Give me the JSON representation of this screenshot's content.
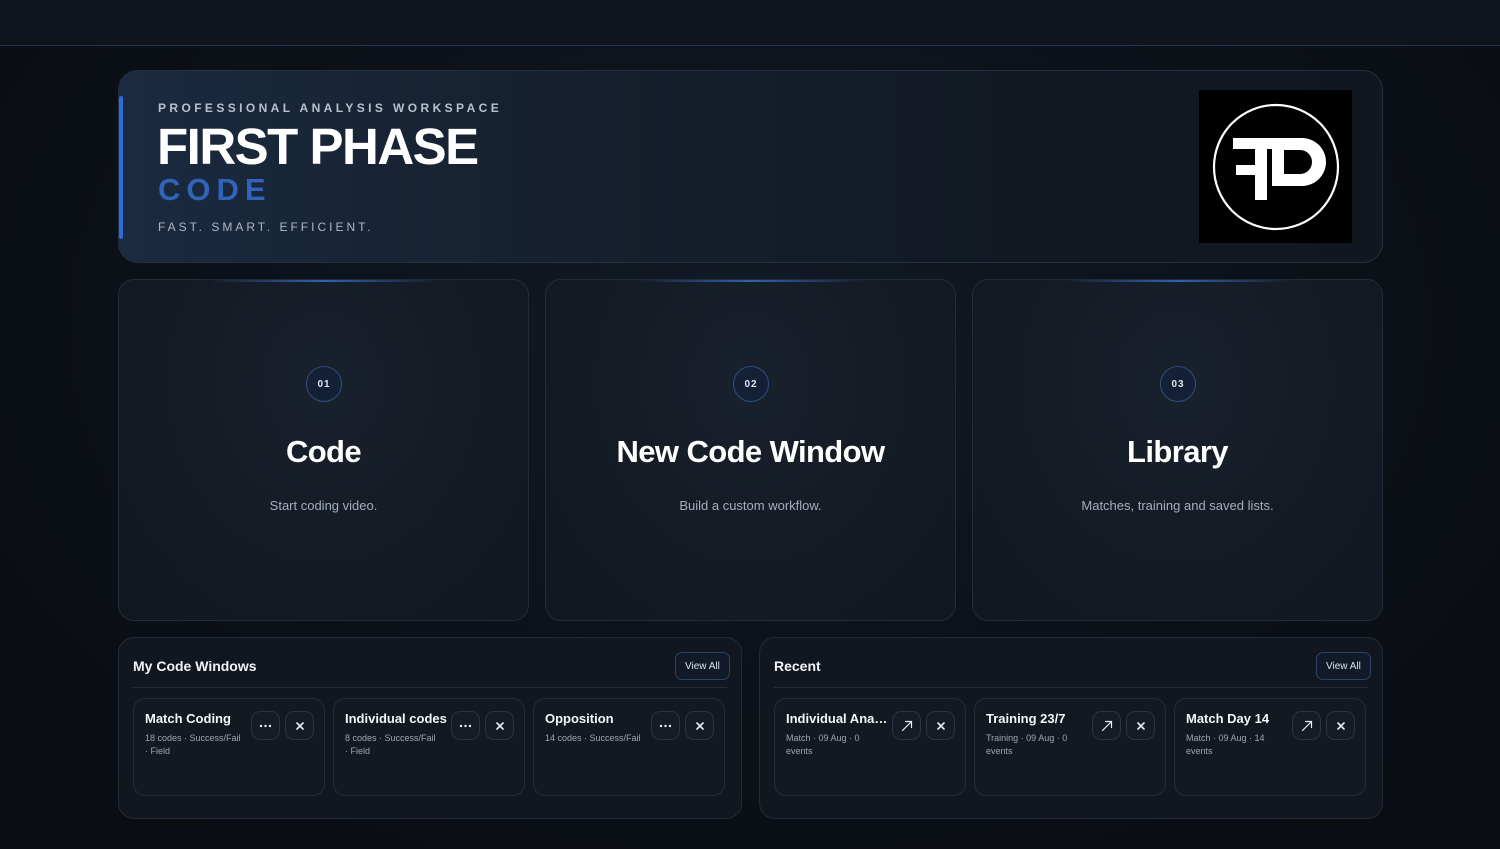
{
  "hero": {
    "eyebrow": "PROFESSIONAL ANALYSIS WORKSPACE",
    "title": "FIRST PHASE",
    "subtitle": "CODE",
    "tagline": "FAST. SMART. EFFICIENT.",
    "logo_text": "FP"
  },
  "cards": [
    {
      "num": "01",
      "title": "Code",
      "desc": "Start coding video."
    },
    {
      "num": "02",
      "title": "New Code Window",
      "desc": "Build a custom workflow."
    },
    {
      "num": "03",
      "title": "Library",
      "desc": "Matches, training and saved lists."
    }
  ],
  "code_windows": {
    "title": "My Code Windows",
    "view_all": "View All",
    "items": [
      {
        "title": "Match Coding",
        "meta": "18 codes · Success/Fail · Field"
      },
      {
        "title": "Individual codes",
        "meta": "8 codes · Success/Fail · Field"
      },
      {
        "title": "Opposition",
        "meta": "14 codes · Success/Fail"
      }
    ]
  },
  "recent": {
    "title": "Recent",
    "view_all": "View All",
    "items": [
      {
        "title": "Individual Analysis",
        "meta": "Match · 09 Aug · 0 events"
      },
      {
        "title": "Training 23/7",
        "meta": "Training · 09 Aug · 0 events"
      },
      {
        "title": "Match Day 14",
        "meta": "Match · 09 Aug · 14 events"
      }
    ]
  },
  "icons": {
    "more": "more-icon",
    "close": "close-icon",
    "open": "open-arrow-icon"
  },
  "colors": {
    "accent": "#2f64b8",
    "background": "#0b0f15",
    "panel": "#12171f"
  }
}
